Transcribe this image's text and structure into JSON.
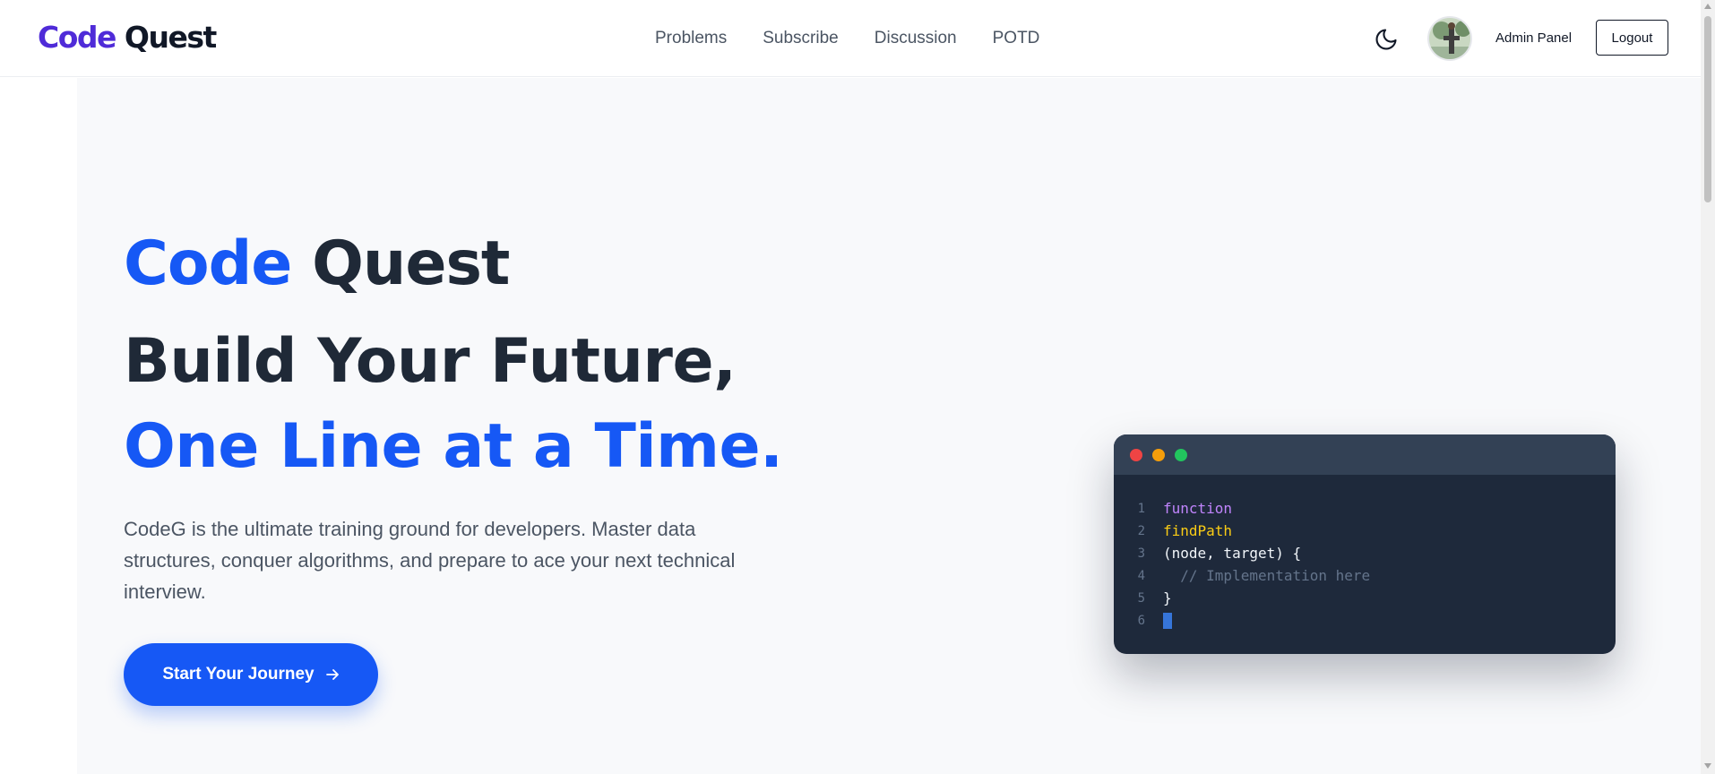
{
  "nav": {
    "logo_part1": "Code",
    "logo_part2": "Quest",
    "links": [
      "Problems",
      "Subscribe",
      "Discussion",
      "POTD"
    ],
    "theme_icon": "moon-icon",
    "admin_label": "Admin Panel",
    "logout_label": "Logout"
  },
  "hero": {
    "brand_part1": "Code",
    "brand_part2": "Quest",
    "headline_line1": "Build Your Future,",
    "headline_line2": "One Line at a Time.",
    "description": "CodeG is the ultimate training ground for developers. Master data structures, conquer algorithms, and prepare to ace your next technical interview.",
    "cta_label": "Start Your Journey",
    "cta_icon": "arrow-right-icon"
  },
  "code_window": {
    "lines": [
      {
        "num": "1",
        "text": "function"
      },
      {
        "num": "2",
        "text": "findPath"
      },
      {
        "num": "3",
        "text": "(node, target) {"
      },
      {
        "num": "4",
        "text": "  // Implementation here"
      },
      {
        "num": "5",
        "text": "}"
      },
      {
        "num": "6",
        "text": ""
      }
    ]
  },
  "colors": {
    "brand_purple": "#4f2bd8",
    "accent_blue": "#1658f5",
    "heading_dark": "#1f2937",
    "code_bg": "#1e293b",
    "code_titlebar": "#334155"
  }
}
